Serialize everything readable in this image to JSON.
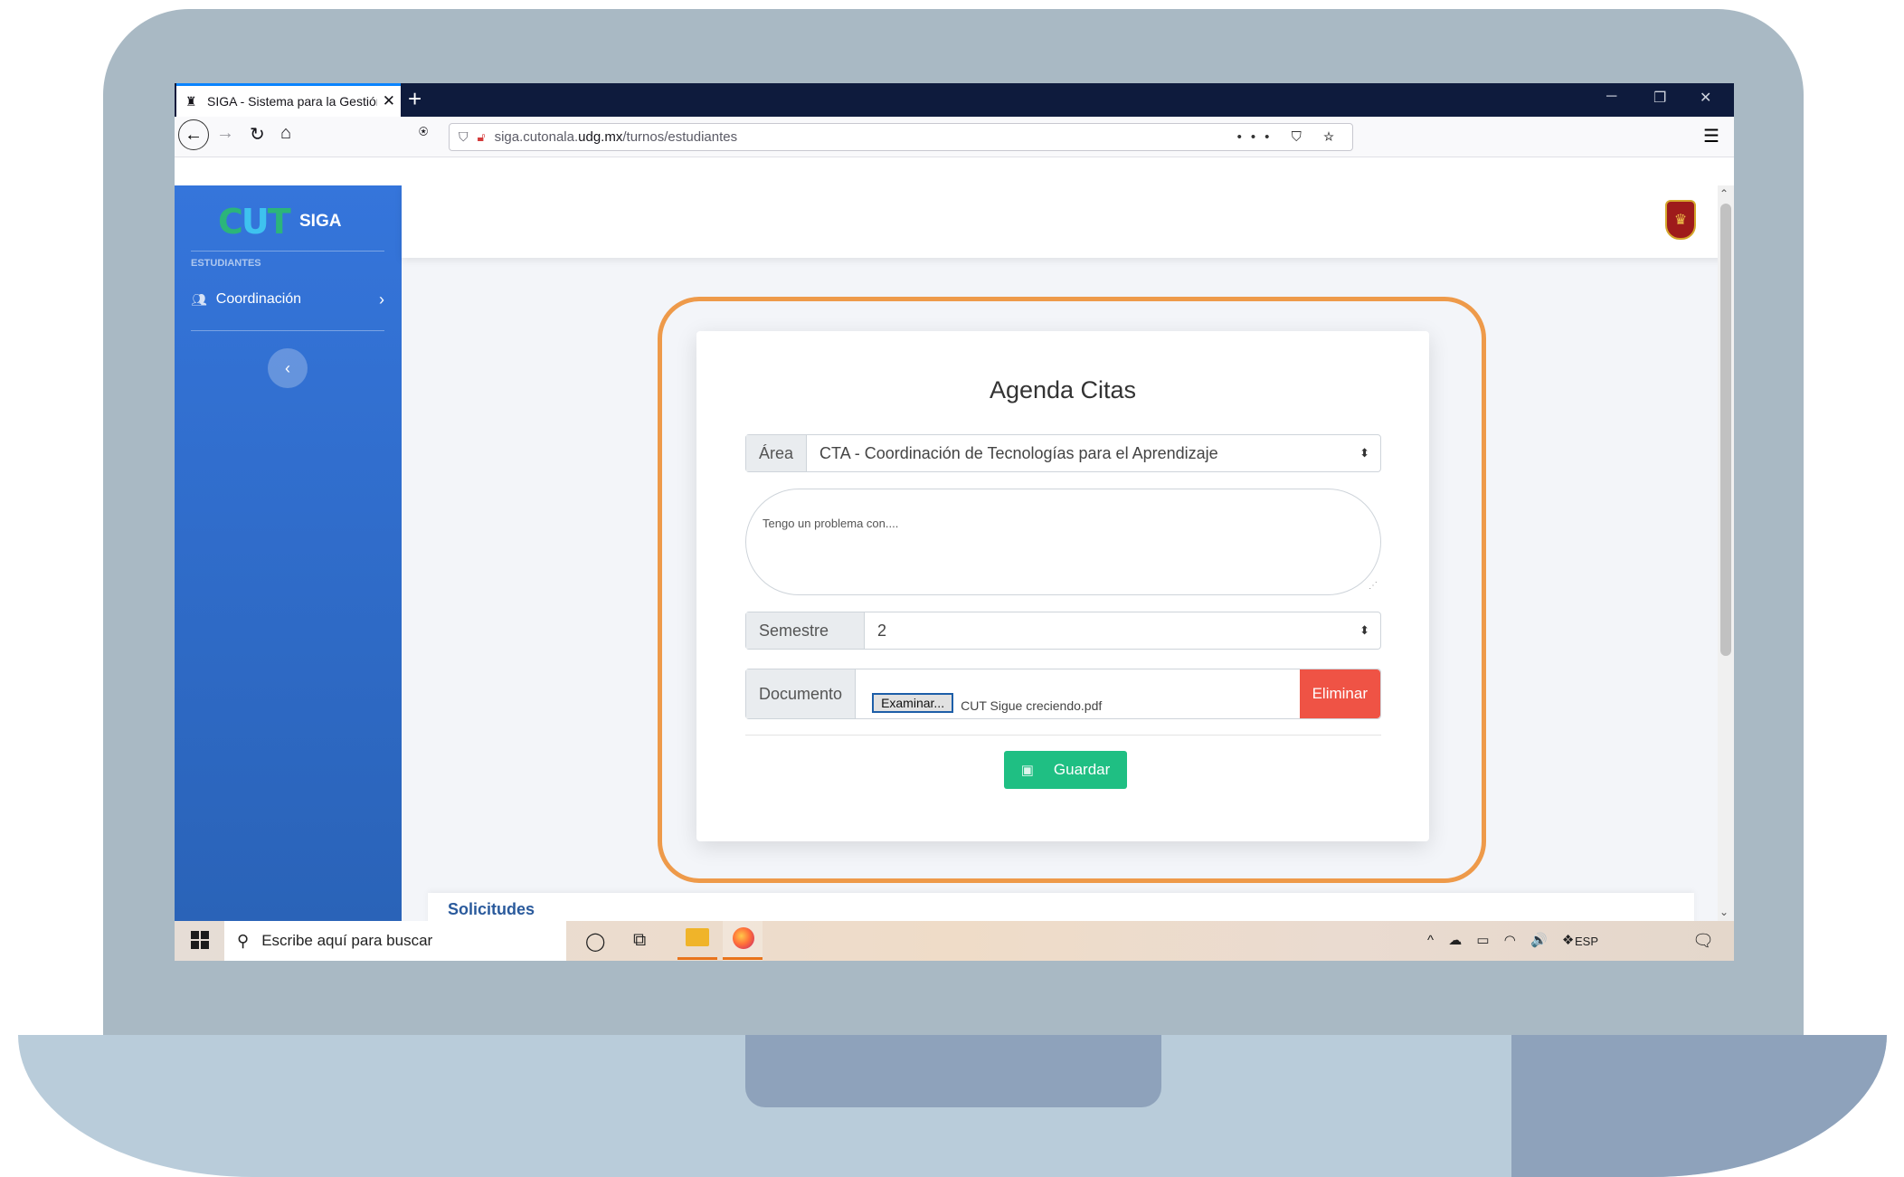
{
  "browser": {
    "tab_title": "SIGA - Sistema para la Gestión",
    "url_host": "siga.cutonala.",
    "url_domain": "udg.mx",
    "url_path": "/turnos/estudiantes",
    "url_actions": "••• ⛉ ☆"
  },
  "sidebar": {
    "brand": "SIGA",
    "logo_text": "CUT",
    "section": "ESTUDIANTES",
    "items": [
      {
        "label": "Coordinación"
      }
    ]
  },
  "form": {
    "title": "Agenda Citas",
    "area_label": "Área",
    "area_value": "CTA - Coordinación de Tecnologías para el Aprendizaje",
    "problem_placeholder": "Tengo un problema con....",
    "semestre_label": "Semestre",
    "semestre_value": "2",
    "documento_label": "Documento",
    "browse_label": "Examinar...",
    "file_name": "CUT Sigue creciendo.pdf",
    "delete_label": "Eliminar",
    "save_label": "Guardar"
  },
  "solicitudes": {
    "title": "Solicitudes"
  },
  "taskbar": {
    "search_placeholder": "Escribe aquí para buscar",
    "lang": "ESP",
    "tray": "^ ☁ ▭ ◠ 🔊 ❖"
  },
  "colors": {
    "sidebar": "#3575db",
    "highlight": "#ee9a4a",
    "save": "#1fbf83",
    "delete": "#ef5345"
  }
}
